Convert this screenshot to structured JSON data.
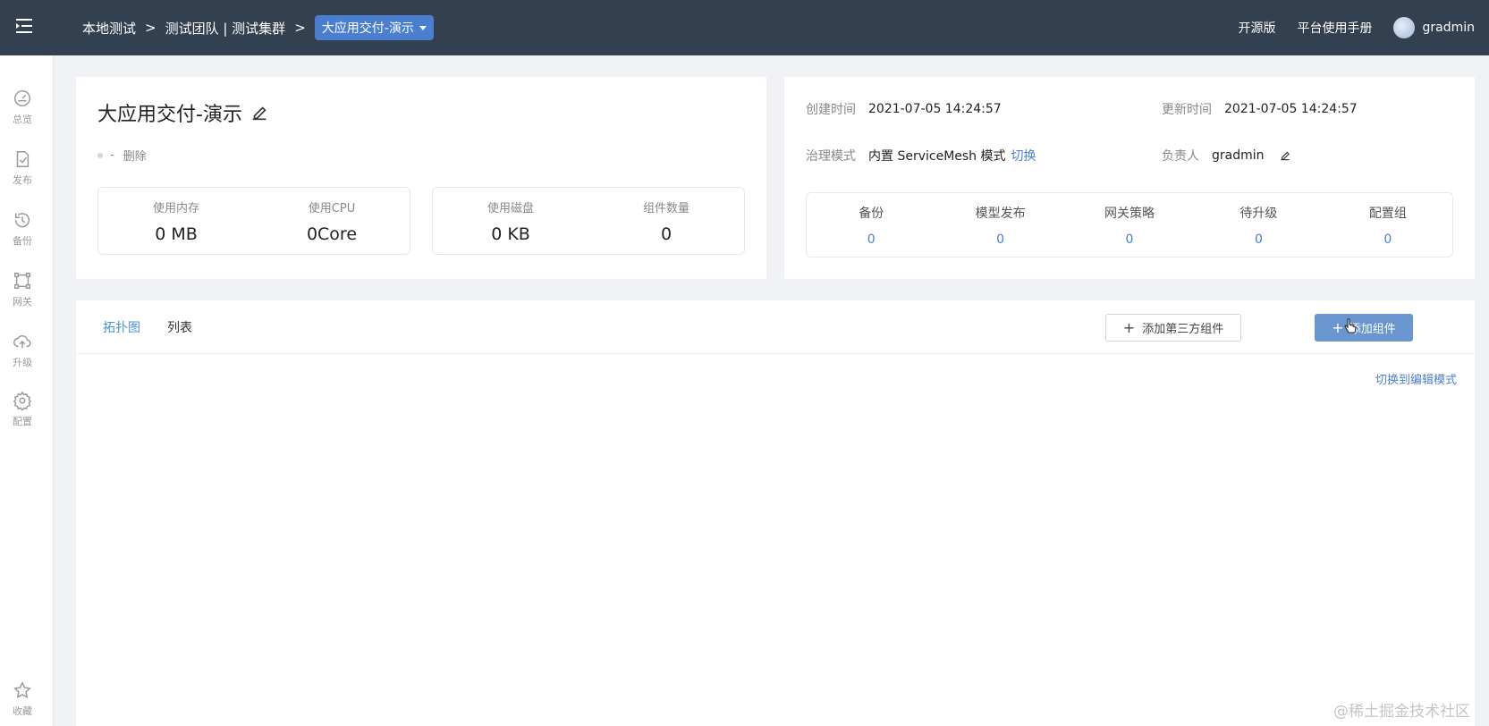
{
  "topbar": {
    "breadcrumb": [
      "本地测试",
      "测试团队 | 测试集群"
    ],
    "separator": ">",
    "current_app": "大应用交付-演示",
    "links": {
      "open_source": "开源版",
      "manual": "平台使用手册"
    },
    "username": "gradmin"
  },
  "sidebar": {
    "items": [
      {
        "label": "总览",
        "icon": "dashboard-icon"
      },
      {
        "label": "发布",
        "icon": "publish-icon"
      },
      {
        "label": "备份",
        "icon": "backup-icon"
      },
      {
        "label": "网关",
        "icon": "gateway-icon"
      },
      {
        "label": "升级",
        "icon": "upgrade-icon"
      },
      {
        "label": "配置",
        "icon": "gear-icon"
      }
    ],
    "favorite": {
      "label": "收藏",
      "icon": "star-icon"
    }
  },
  "app_info": {
    "title": "大应用交付-演示",
    "status": "-",
    "delete_label": "删除",
    "stats_left": [
      {
        "label": "使用内存",
        "value": "0 MB"
      },
      {
        "label": "使用CPU",
        "value": "0Core"
      }
    ],
    "stats_right": [
      {
        "label": "使用磁盘",
        "value": "0 KB"
      },
      {
        "label": "组件数量",
        "value": "0"
      }
    ]
  },
  "meta": {
    "created_label": "创建时间",
    "created_value": "2021-07-05 14:24:57",
    "updated_label": "更新时间",
    "updated_value": "2021-07-05 14:24:57",
    "governance_label": "治理模式",
    "governance_value": "内置 ServiceMesh 模式",
    "switch_label": "切换",
    "owner_label": "负责人",
    "owner_value": "gradmin",
    "counts": [
      {
        "label": "备份",
        "value": "0"
      },
      {
        "label": "模型发布",
        "value": "0"
      },
      {
        "label": "网关策略",
        "value": "0"
      },
      {
        "label": "待升级",
        "value": "0"
      },
      {
        "label": "配置组",
        "value": "0"
      }
    ]
  },
  "main": {
    "tabs": [
      {
        "label": "拓扑图",
        "active": true
      },
      {
        "label": "列表",
        "active": false
      }
    ],
    "add_third_party_label": "添加第三方组件",
    "add_component_label": "添加组件",
    "edit_mode_label": "切换到编辑模式"
  },
  "watermark": "@稀土掘金技术社区",
  "colors": {
    "topbar": "#33404f",
    "accent": "#4a7fd0",
    "primary_button": "#6a96cf"
  }
}
